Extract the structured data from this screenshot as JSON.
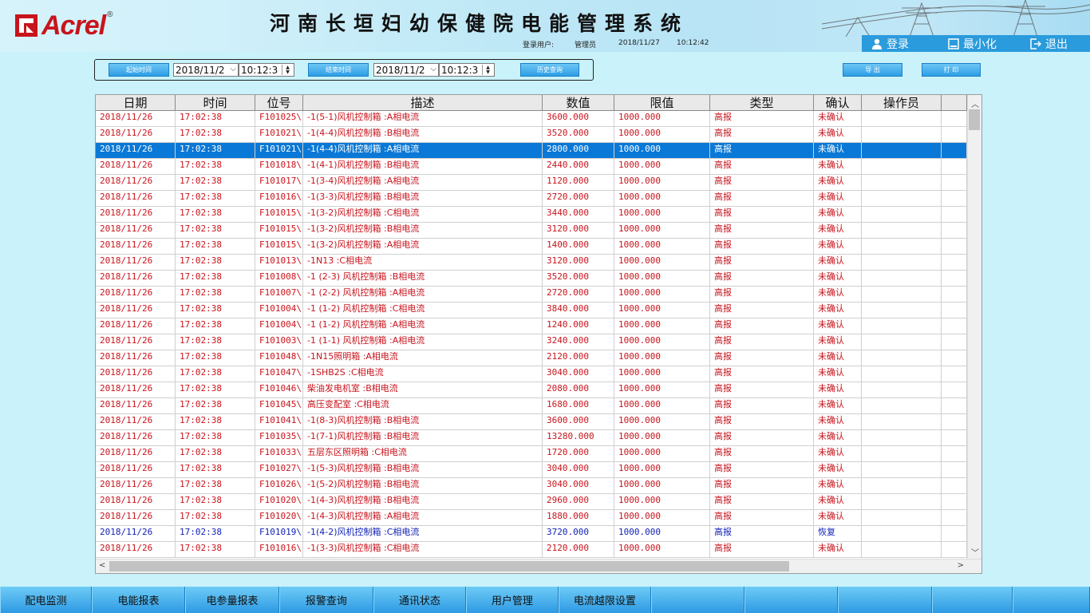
{
  "header": {
    "logo_text": "Acrel",
    "logo_reg": "®",
    "title": "河南长垣妇幼保健院电能管理系统",
    "login_label": "登录用户:",
    "login_user": "管理员",
    "login_date": "2018/11/27",
    "login_time": "10:12:42",
    "btn_login": "登录",
    "btn_minimize": "最小化",
    "btn_exit": "退出"
  },
  "query": {
    "start_btn": "起始时间",
    "start_date": "2018/11/2",
    "start_time": "10:12:3",
    "end_btn": "结束时间",
    "end_date": "2018/11/2",
    "end_time": "10:12:3",
    "history_btn": "历史查询",
    "export_btn": "导 出",
    "print_btn": "打 印"
  },
  "table": {
    "columns": [
      "日期",
      "时间",
      "位号",
      "描述",
      "数值",
      "限值",
      "类型",
      "确认",
      "操作员"
    ],
    "rows": [
      [
        "2018/11/26",
        "17:02:38",
        "F101025\\",
        "-1(5-1)风机控制箱 :A相电流",
        "3600.000",
        "1000.000",
        "高报",
        "未确认",
        ""
      ],
      [
        "2018/11/26",
        "17:02:38",
        "F101021\\",
        "-1(4-4)风机控制箱 :B相电流",
        "3520.000",
        "1000.000",
        "高报",
        "未确认",
        ""
      ],
      [
        "2018/11/26",
        "17:02:38",
        "F101021\\",
        "-1(4-4)风机控制箱 :A相电流",
        "2800.000",
        "1000.000",
        "高报",
        "未确认",
        ""
      ],
      [
        "2018/11/26",
        "17:02:38",
        "F101018\\",
        "-1(4-1)风机控制箱 :B相电流",
        "2440.000",
        "1000.000",
        "高报",
        "未确认",
        ""
      ],
      [
        "2018/11/26",
        "17:02:38",
        "F101017\\",
        "-1(3-4)风机控制箱 :A相电流",
        "1120.000",
        "1000.000",
        "高报",
        "未确认",
        ""
      ],
      [
        "2018/11/26",
        "17:02:38",
        "F101016\\",
        "-1(3-3)风机控制箱 :B相电流",
        "2720.000",
        "1000.000",
        "高报",
        "未确认",
        ""
      ],
      [
        "2018/11/26",
        "17:02:38",
        "F101015\\",
        "-1(3-2)风机控制箱 :C相电流",
        "3440.000",
        "1000.000",
        "高报",
        "未确认",
        ""
      ],
      [
        "2018/11/26",
        "17:02:38",
        "F101015\\",
        "-1(3-2)风机控制箱 :B相电流",
        "3120.000",
        "1000.000",
        "高报",
        "未确认",
        ""
      ],
      [
        "2018/11/26",
        "17:02:38",
        "F101015\\",
        "-1(3-2)风机控制箱 :A相电流",
        "1400.000",
        "1000.000",
        "高报",
        "未确认",
        ""
      ],
      [
        "2018/11/26",
        "17:02:38",
        "F101013\\",
        "-1N13 :C相电流",
        "3120.000",
        "1000.000",
        "高报",
        "未确认",
        ""
      ],
      [
        "2018/11/26",
        "17:02:38",
        "F101008\\",
        "-1 (2-3) 风机控制箱 :B相电流",
        "3520.000",
        "1000.000",
        "高报",
        "未确认",
        ""
      ],
      [
        "2018/11/26",
        "17:02:38",
        "F101007\\",
        "-1 (2-2) 风机控制箱 :A相电流",
        "2720.000",
        "1000.000",
        "高报",
        "未确认",
        ""
      ],
      [
        "2018/11/26",
        "17:02:38",
        "F101004\\",
        "-1 (1-2) 风机控制箱 :C相电流",
        "3840.000",
        "1000.000",
        "高报",
        "未确认",
        ""
      ],
      [
        "2018/11/26",
        "17:02:38",
        "F101004\\",
        "-1 (1-2) 风机控制箱 :A相电流",
        "1240.000",
        "1000.000",
        "高报",
        "未确认",
        ""
      ],
      [
        "2018/11/26",
        "17:02:38",
        "F101003\\",
        "-1 (1-1) 风机控制箱 :A相电流",
        "3240.000",
        "1000.000",
        "高报",
        "未确认",
        ""
      ],
      [
        "2018/11/26",
        "17:02:38",
        "F101048\\",
        "-1N15照明箱 :A相电流",
        "2120.000",
        "1000.000",
        "高报",
        "未确认",
        ""
      ],
      [
        "2018/11/26",
        "17:02:38",
        "F101047\\",
        "-1SHB2S :C相电流",
        "3040.000",
        "1000.000",
        "高报",
        "未确认",
        ""
      ],
      [
        "2018/11/26",
        "17:02:38",
        "F101046\\",
        "柴油发电机室 :B相电流",
        "2080.000",
        "1000.000",
        "高报",
        "未确认",
        ""
      ],
      [
        "2018/11/26",
        "17:02:38",
        "F101045\\",
        "高压变配室 :C相电流",
        "1680.000",
        "1000.000",
        "高报",
        "未确认",
        ""
      ],
      [
        "2018/11/26",
        "17:02:38",
        "F101041\\",
        "-1(8-3)风机控制箱 :B相电流",
        "3600.000",
        "1000.000",
        "高报",
        "未确认",
        ""
      ],
      [
        "2018/11/26",
        "17:02:38",
        "F101035\\",
        "-1(7-1)风机控制箱 :B相电流",
        "13280.000",
        "1000.000",
        "高报",
        "未确认",
        ""
      ],
      [
        "2018/11/26",
        "17:02:38",
        "F101033\\",
        "五层东区照明箱 :C相电流",
        "1720.000",
        "1000.000",
        "高报",
        "未确认",
        ""
      ],
      [
        "2018/11/26",
        "17:02:38",
        "F101027\\",
        "-1(5-3)风机控制箱 :B相电流",
        "3040.000",
        "1000.000",
        "高报",
        "未确认",
        ""
      ],
      [
        "2018/11/26",
        "17:02:38",
        "F101026\\",
        "-1(5-2)风机控制箱 :B相电流",
        "3040.000",
        "1000.000",
        "高报",
        "未确认",
        ""
      ],
      [
        "2018/11/26",
        "17:02:38",
        "F101020\\",
        "-1(4-3)风机控制箱 :B相电流",
        "2960.000",
        "1000.000",
        "高报",
        "未确认",
        ""
      ],
      [
        "2018/11/26",
        "17:02:38",
        "F101020\\",
        "-1(4-3)风机控制箱 :A相电流",
        "1880.000",
        "1000.000",
        "高报",
        "未确认",
        ""
      ],
      [
        "2018/11/26",
        "17:02:38",
        "F101019\\",
        "-1(4-2)风机控制箱 :C相电流",
        "3720.000",
        "1000.000",
        "高报",
        "恢复",
        ""
      ],
      [
        "2018/11/26",
        "17:02:38",
        "F101016\\",
        "-1(3-3)风机控制箱 :C相电流",
        "2120.000",
        "1000.000",
        "高报",
        "未确认",
        ""
      ]
    ],
    "selected_row": 2,
    "row_colors": {
      "alarm": "#c8141c",
      "recovered": "#1222b8"
    }
  },
  "bottom_nav": [
    "配电监测",
    "电能报表",
    "电参量报表",
    "报警查询",
    "通讯状态",
    "用户管理",
    "电流越限设置",
    "",
    "",
    "",
    "",
    ""
  ],
  "colors": {
    "accent": "#2a9bdc",
    "selection": "#0a78d6",
    "background": "#c9f2fa"
  }
}
